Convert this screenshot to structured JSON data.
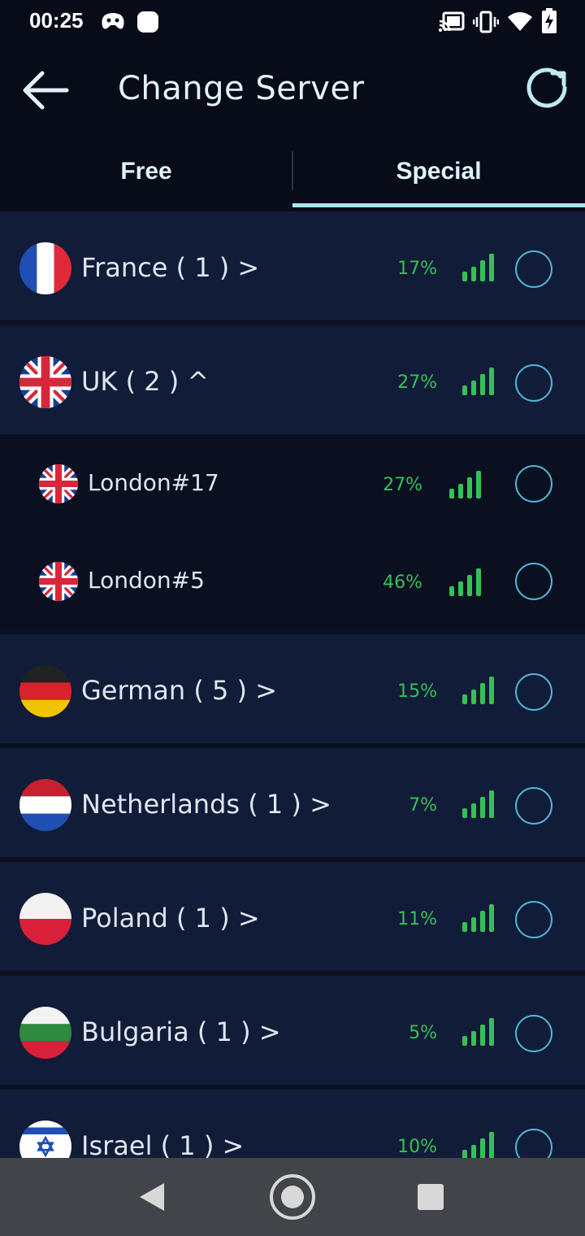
{
  "status_bar": {
    "time": "00:25",
    "icons": [
      "game-controller-icon",
      "app-notification-icon",
      "cast-icon",
      "vibrate-icon",
      "wifi-icon",
      "battery-charging-icon"
    ]
  },
  "header": {
    "title": "Change Server",
    "back_icon": "arrow-left-icon",
    "refresh_icon": "refresh-icon"
  },
  "tabs": [
    {
      "label": "Free",
      "selected": false
    },
    {
      "label": "Special",
      "selected": true
    }
  ],
  "colors": {
    "accent": "#a9e4ee",
    "load_green": "#35c155",
    "radio_border": "#4fb6d6",
    "row_bg": "#111c38"
  },
  "servers": [
    {
      "name": "France ( 1 ) >",
      "load": "17%",
      "signal_bars": 4,
      "flag": "france",
      "selected": false
    },
    {
      "name": "UK ( 2 ) ^",
      "load": "27%",
      "signal_bars": 4,
      "flag": "uk",
      "selected": false,
      "expanded": true,
      "children": [
        {
          "name": "London#17",
          "load": "27%",
          "signal_bars": 4,
          "flag": "uk",
          "selected": false
        },
        {
          "name": "London#5",
          "load": "46%",
          "signal_bars": 4,
          "flag": "uk",
          "selected": false
        }
      ]
    },
    {
      "name": "German ( 5 ) >",
      "load": "15%",
      "signal_bars": 4,
      "flag": "germany",
      "selected": false
    },
    {
      "name": "Netherlands ( 1 ) >",
      "load": "7%",
      "signal_bars": 4,
      "flag": "netherlands",
      "selected": false
    },
    {
      "name": "Poland ( 1 ) >",
      "load": "11%",
      "signal_bars": 4,
      "flag": "poland",
      "selected": false
    },
    {
      "name": "Bulgaria ( 1 ) >",
      "load": "5%",
      "signal_bars": 4,
      "flag": "bulgaria",
      "selected": false
    },
    {
      "name": "Israel ( 1 ) >",
      "load": "10%",
      "signal_bars": 4,
      "flag": "israel",
      "selected": false
    }
  ],
  "nav_bar": {
    "back_icon": "nav-back-icon",
    "home_icon": "nav-home-icon",
    "recents_icon": "nav-recents-icon"
  }
}
